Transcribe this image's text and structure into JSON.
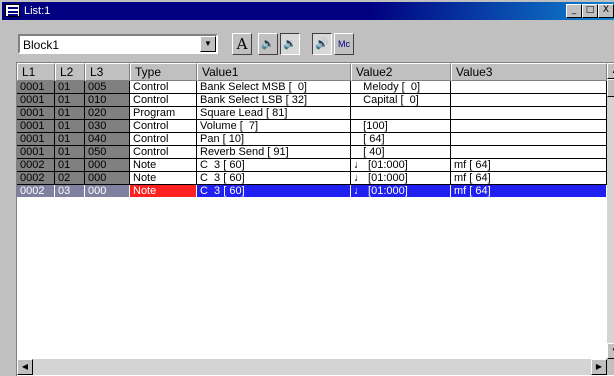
{
  "window": {
    "title": "List:1"
  },
  "titlebar_buttons": {
    "minimize": "_",
    "restore": "□",
    "close": "X"
  },
  "toolbar": {
    "block_select": {
      "value": "Block1",
      "arrow": "▼"
    },
    "buttons": [
      {
        "name": "font-button",
        "label": "A",
        "icon": "letter-a-icon"
      },
      {
        "name": "speaker-in-button",
        "label": "🔈",
        "icon": "speaker-in-icon"
      },
      {
        "name": "speaker-out-button",
        "label": "🔉",
        "icon": "speaker-out-icon"
      },
      {
        "name": "speaker-play-button",
        "label": "🔊",
        "icon": "speaker-play-icon"
      },
      {
        "name": "mc-button",
        "label": "Mc",
        "icon": "mc-icon"
      }
    ]
  },
  "columns": [
    "L1",
    "L2",
    "L3",
    "Type",
    "Value1",
    "Value2",
    "Value3"
  ],
  "rows": [
    {
      "l1": "0001",
      "l2": "01",
      "l3": "005",
      "type": "Control",
      "v1": "Bank Select MSB [  0]",
      "v2": "   Melody [  0]",
      "v3": ""
    },
    {
      "l1": "0001",
      "l2": "01",
      "l3": "010",
      "type": "Control",
      "v1": "Bank Select LSB [ 32]",
      "v2": "   Capital [  0]",
      "v3": ""
    },
    {
      "l1": "0001",
      "l2": "01",
      "l3": "020",
      "type": "Program",
      "v1": "Square Lead [ 81]",
      "v2": "",
      "v3": ""
    },
    {
      "l1": "0001",
      "l2": "01",
      "l3": "030",
      "type": "Control",
      "v1": "Volume [  7]",
      "v2": "   [100]",
      "v3": ""
    },
    {
      "l1": "0001",
      "l2": "01",
      "l3": "040",
      "type": "Control",
      "v1": "Pan [ 10]",
      "v2": "   [ 64]",
      "v3": ""
    },
    {
      "l1": "0001",
      "l2": "01",
      "l3": "050",
      "type": "Control",
      "v1": "Reverb Send [ 91]",
      "v2": "   [ 40]",
      "v3": ""
    },
    {
      "l1": "0002",
      "l2": "01",
      "l3": "000",
      "type": "Note",
      "v1": "C  3 [ 60]",
      "v2": "♩ [01:000]",
      "v3": "mf [ 64]"
    },
    {
      "l1": "0002",
      "l2": "02",
      "l3": "000",
      "type": "Note",
      "v1": "C  3 [ 60]",
      "v2": "♩ [01:000]",
      "v3": "mf [ 64]"
    },
    {
      "l1": "0002",
      "l2": "03",
      "l3": "000",
      "type": "Note",
      "v1": "C  3 [ 60]",
      "v2": "♩ [01:000]",
      "v3": "mf [ 64]"
    }
  ],
  "selected_row_index": 8,
  "scrollbar": {
    "up": "▲",
    "down": "▼",
    "left": "◀",
    "right": "▶"
  }
}
